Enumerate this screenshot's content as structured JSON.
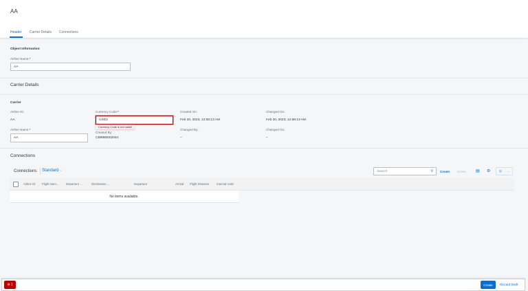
{
  "header": {
    "title": "AA",
    "tabs": [
      {
        "label": "Header",
        "selected": true
      },
      {
        "label": "Carrier Details"
      },
      {
        "label": "Connections"
      }
    ]
  },
  "object_info": {
    "heading": "Object Information",
    "airline_name_label": "Airline Name:",
    "airline_name_value": "AA"
  },
  "carrier_details": {
    "heading": "Carrier Details",
    "group": "Carrier",
    "airline_id_label": "Airline ID:",
    "airline_id_value": "AA",
    "currency_label": "Currency Code:",
    "currency_value": "USD2",
    "currency_error": "Currency Code is not valid2",
    "created_on_label": "Created On:",
    "created_on_value": "Feb 20, 2023, 12:58:13 AM",
    "changed_on_label": "Changed On:",
    "changed_on_value": "Feb 20, 2023, 12:58:13 AM",
    "airline_name_label": "Airline Name:",
    "airline_name_value": "AA",
    "created_by_label": "Created By:",
    "created_by_value": "CB9980002044",
    "changed_by_label": "Changed By:",
    "changed_by_value": "–",
    "changed_on2_label": "Changed On:",
    "changed_on2_value": "–"
  },
  "connections": {
    "heading": "Connections",
    "table_title": "Connections",
    "variant": "Standard",
    "search_placeholder": "Search",
    "create": "Create",
    "delete": "Delete",
    "columns": [
      "Airline ID",
      "Flight Num...",
      "Departure ...",
      "Destination ...",
      "Departure",
      "Arrival",
      "Flight Distance",
      "Internal UoM"
    ],
    "empty": "No items available."
  },
  "footer": {
    "error_count": "1",
    "create": "Create",
    "discard": "Discard Draft"
  },
  "colors": {
    "accent": "#0a6ed1",
    "error": "#bb0000"
  }
}
